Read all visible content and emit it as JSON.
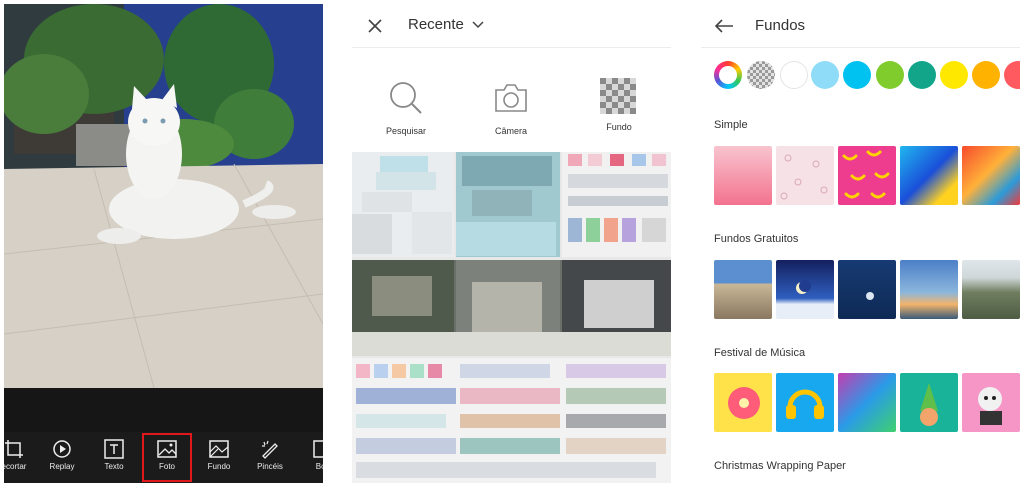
{
  "editor": {
    "tools": [
      {
        "label": "ecortar",
        "icon": "crop-icon"
      },
      {
        "label": "Replay",
        "icon": "replay-icon"
      },
      {
        "label": "Texto",
        "icon": "text-icon"
      },
      {
        "label": "Foto",
        "icon": "photo-icon",
        "selected": true
      },
      {
        "label": "Fundo",
        "icon": "background-icon"
      },
      {
        "label": "Pincéis",
        "icon": "brush-icon"
      },
      {
        "label": "Bor",
        "icon": "border-icon"
      }
    ]
  },
  "picker": {
    "album_label": "Recente",
    "sources": [
      {
        "label": "Pesquisar",
        "icon": "search-icon"
      },
      {
        "label": "Câmera",
        "icon": "camera-icon"
      },
      {
        "label": "Fundo",
        "icon": "transparent-grid-icon",
        "selected": true
      }
    ]
  },
  "backgrounds": {
    "title": "Fundos",
    "colors": [
      "#ffffff",
      "#8fdcf8",
      "#00c2f0",
      "#7fcc2c",
      "#12a58a",
      "#ffe800",
      "#ffb200",
      "#ff5a5f"
    ],
    "sections": [
      {
        "title": "Simple"
      },
      {
        "title": "Fundos Gratuitos"
      },
      {
        "title": "Festival de Música"
      },
      {
        "title": "Christmas Wrapping Paper"
      }
    ]
  }
}
